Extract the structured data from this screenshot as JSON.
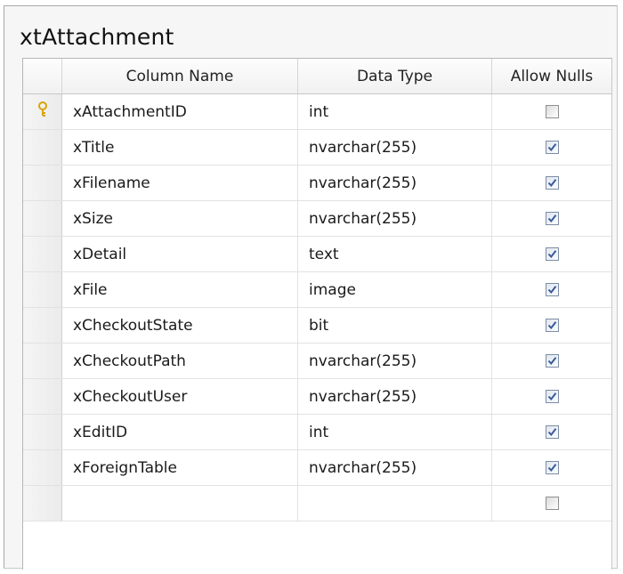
{
  "table": {
    "title": "xtAttachment",
    "headers": {
      "column_name": "Column Name",
      "data_type": "Data Type",
      "allow_nulls": "Allow Nulls"
    },
    "rows": [
      {
        "name": "xAttachmentID",
        "type": "int",
        "allow_nulls": false,
        "primary_key": true
      },
      {
        "name": "xTitle",
        "type": "nvarchar(255)",
        "allow_nulls": true,
        "primary_key": false
      },
      {
        "name": "xFilename",
        "type": "nvarchar(255)",
        "allow_nulls": true,
        "primary_key": false
      },
      {
        "name": "xSize",
        "type": "nvarchar(255)",
        "allow_nulls": true,
        "primary_key": false
      },
      {
        "name": "xDetail",
        "type": "text",
        "allow_nulls": true,
        "primary_key": false
      },
      {
        "name": "xFile",
        "type": "image",
        "allow_nulls": true,
        "primary_key": false
      },
      {
        "name": "xCheckoutState",
        "type": "bit",
        "allow_nulls": true,
        "primary_key": false
      },
      {
        "name": "xCheckoutPath",
        "type": "nvarchar(255)",
        "allow_nulls": true,
        "primary_key": false
      },
      {
        "name": "xCheckoutUser",
        "type": "nvarchar(255)",
        "allow_nulls": true,
        "primary_key": false
      },
      {
        "name": "xEditID",
        "type": "int",
        "allow_nulls": true,
        "primary_key": false
      },
      {
        "name": "xForeignTable",
        "type": "nvarchar(255)",
        "allow_nulls": true,
        "primary_key": false
      },
      {
        "name": "",
        "type": "",
        "allow_nulls": false,
        "primary_key": false
      }
    ]
  },
  "icons": {
    "primary_key": "key-icon",
    "checkbox_checked": "checkbox-checked-icon",
    "checkbox_unchecked": "checkbox-unchecked-icon"
  },
  "colors": {
    "key_icon": "#d9a400",
    "checkmark": "#3a5a9a"
  }
}
